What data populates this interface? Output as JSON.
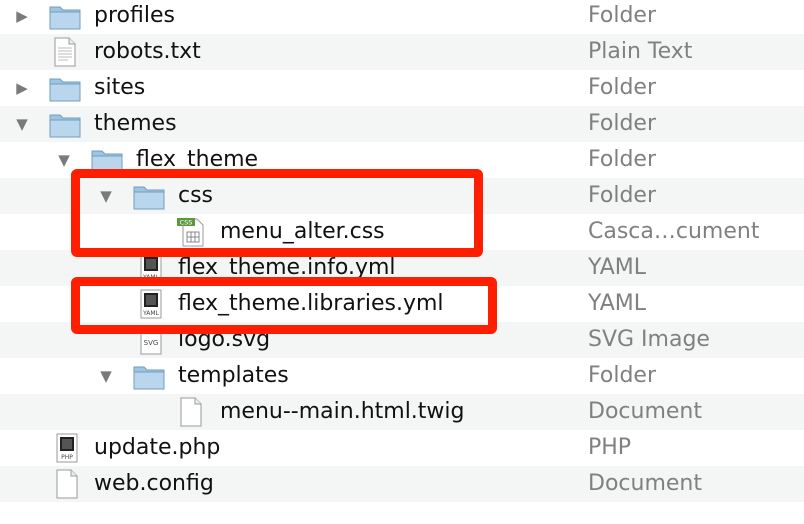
{
  "highlight_color": "#ff1f00",
  "rows": [
    {
      "name": "profiles",
      "kind": "Folder",
      "icon": "folder-icon",
      "disclosure": "collapsed"
    },
    {
      "name": "robots.txt",
      "kind": "Plain Text",
      "icon": "text-file-icon",
      "disclosure": "none"
    },
    {
      "name": "sites",
      "kind": "Folder",
      "icon": "folder-icon",
      "disclosure": "collapsed"
    },
    {
      "name": "themes",
      "kind": "Folder",
      "icon": "folder-icon",
      "disclosure": "expanded"
    },
    {
      "name": "flex_theme",
      "kind": "Folder",
      "icon": "folder-icon",
      "disclosure": "expanded"
    },
    {
      "name": "css",
      "kind": "Folder",
      "icon": "folder-icon",
      "disclosure": "expanded"
    },
    {
      "name": "menu_alter.css",
      "kind": "Casca…cument",
      "icon": "css-file-icon",
      "disclosure": "none",
      "badge": "CSS"
    },
    {
      "name": "flex_theme.info.yml",
      "kind": "YAML",
      "icon": "yaml-file-icon",
      "disclosure": "none",
      "badge": "YAML"
    },
    {
      "name": "flex_theme.libraries.yml",
      "kind": "YAML",
      "icon": "yaml-file-icon",
      "disclosure": "none",
      "badge": "YAML"
    },
    {
      "name": "logo.svg",
      "kind": "SVG Image",
      "icon": "svg-file-icon",
      "disclosure": "none",
      "badge": "SVG"
    },
    {
      "name": "templates",
      "kind": "Folder",
      "icon": "folder-icon",
      "disclosure": "expanded"
    },
    {
      "name": "menu--main.html.twig",
      "kind": "Document",
      "icon": "document-icon",
      "disclosure": "none"
    },
    {
      "name": "update.php",
      "kind": "PHP",
      "icon": "php-file-icon",
      "disclosure": "none",
      "badge": "PHP"
    },
    {
      "name": "web.config",
      "kind": "Document",
      "icon": "document-icon",
      "disclosure": "none"
    }
  ]
}
